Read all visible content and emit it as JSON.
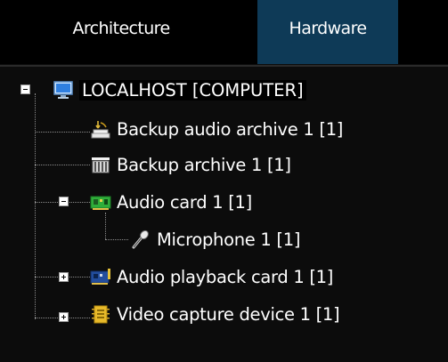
{
  "tabs": [
    {
      "label": "Architecture",
      "active": false
    },
    {
      "label": "Hardware",
      "active": true
    }
  ],
  "tree": {
    "root": {
      "label": "LOCALHOST [COMPUTER]",
      "icon": "computer-icon",
      "expanded": true
    },
    "children": [
      {
        "label": "Backup audio archive 1 [1]",
        "icon": "backup-audio-archive-icon"
      },
      {
        "label": "Backup archive 1 [1]",
        "icon": "backup-archive-icon"
      },
      {
        "label": "Audio card 1 [1]",
        "icon": "audio-card-icon",
        "expanded": true,
        "children": [
          {
            "label": "Microphone 1 [1]",
            "icon": "microphone-icon"
          }
        ]
      },
      {
        "label": "Audio playback card 1 [1]",
        "icon": "audio-playback-card-icon",
        "expanded": false
      },
      {
        "label": "Video capture device 1 [1]",
        "icon": "video-capture-device-icon",
        "expanded": false
      }
    ]
  },
  "colors": {
    "active_tab_bg": "#0e3a57",
    "background": "#0c0c0c",
    "text": "#ffffff"
  }
}
